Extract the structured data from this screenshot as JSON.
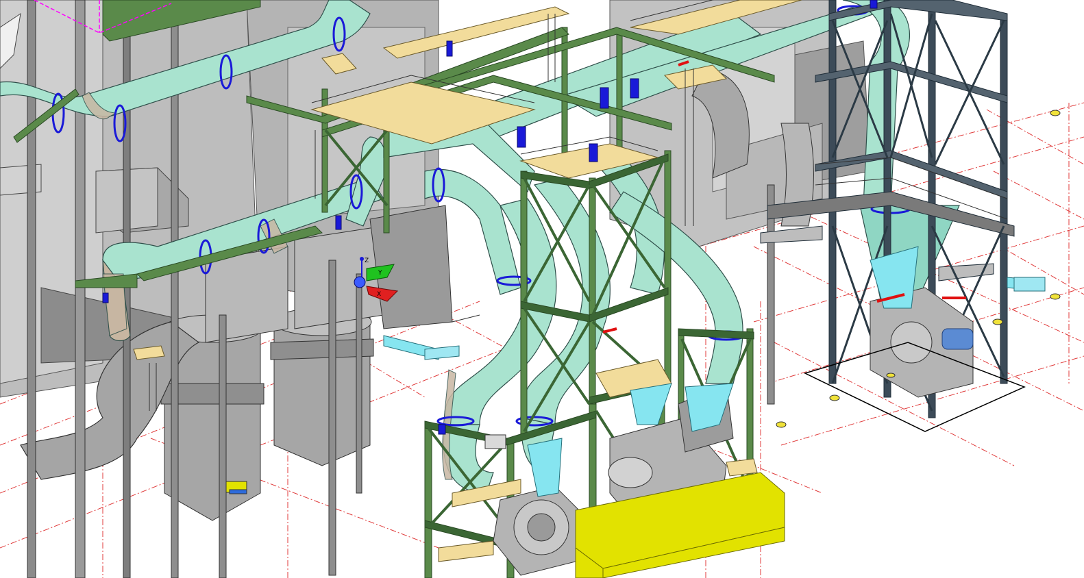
{
  "app": {
    "view_type": "3D isometric plant model viewport"
  },
  "colors": {
    "background": "#ffffff",
    "duct": "#a9e3cf",
    "duct_stroke": "#2f4f4a",
    "insulation_band": "#c8b7a3",
    "steel": "#5a8a4a",
    "steel_dark": "#3b6634",
    "grey_equipment": "#a9a9a9",
    "grey_dark": "#6d6d6d",
    "walkway": "#f2dc9b",
    "base_plate": "#e2e200",
    "flange": "#1a1ad8",
    "light_blue": "#86e5f0",
    "grid_lines": "#e03a3a",
    "selection": "#ff00ff",
    "motor_blue": "#5b8bd3"
  },
  "gizmo": {
    "x_label": "X",
    "y_label": "Y",
    "z_label": "Z"
  },
  "layers": [
    "grid",
    "grey-buildings",
    "ducts",
    "steel-structures",
    "walkways",
    "fan-units",
    "base-plates",
    "markers",
    "transform-gizmo"
  ]
}
